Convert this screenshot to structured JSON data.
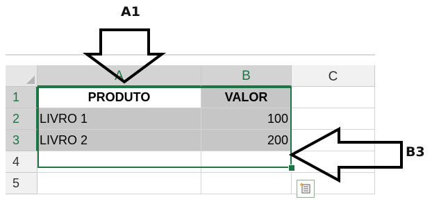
{
  "callouts": {
    "a1": "A1",
    "b3": "B3"
  },
  "column_headers": [
    "A",
    "B",
    "C"
  ],
  "row_headers": [
    "1",
    "2",
    "3",
    "4",
    "5"
  ],
  "cells": {
    "a1": "PRODUTO",
    "b1": "VALOR",
    "a2": "LIVRO 1",
    "b2": "100",
    "a3": "LIVRO 2",
    "b3": "200"
  },
  "selection": {
    "range": "A1:B3",
    "accent_color": "#217346"
  },
  "quick_analysis_icon": "quick-analysis-icon"
}
